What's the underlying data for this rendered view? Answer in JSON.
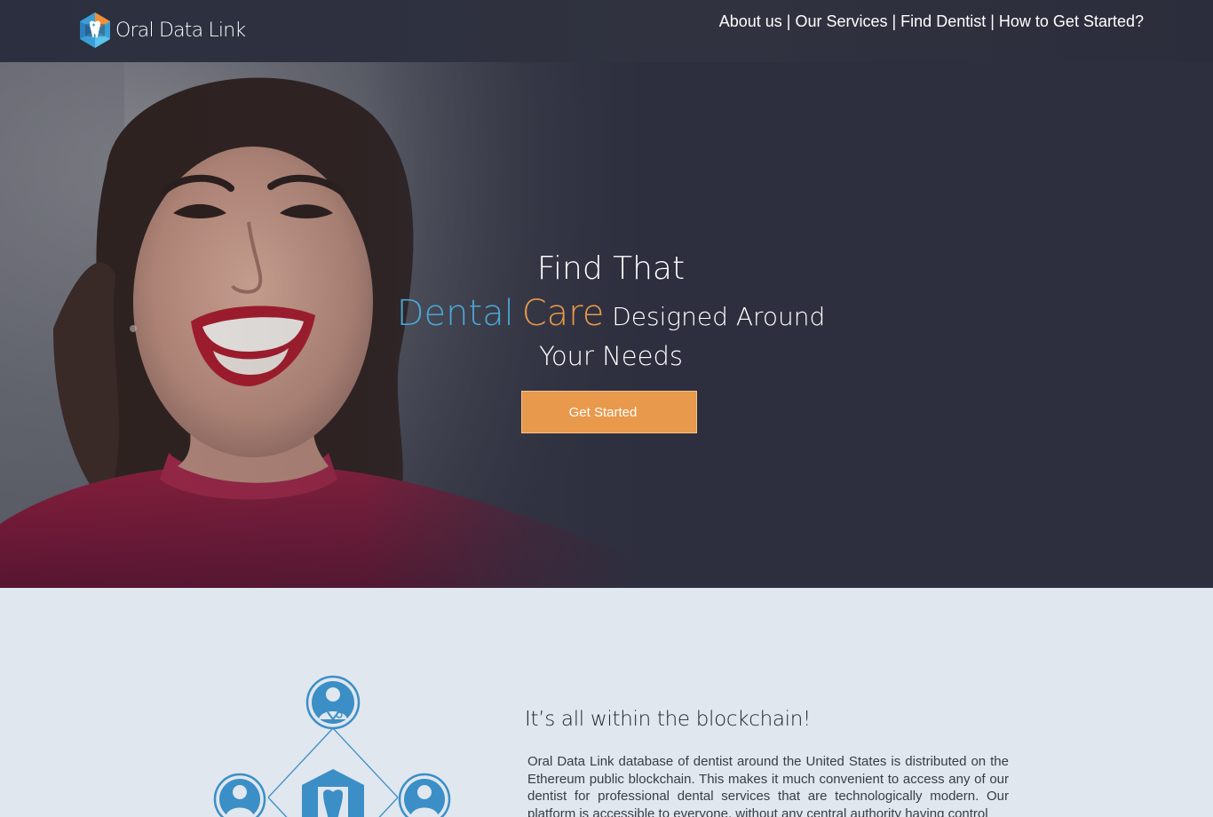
{
  "brand": {
    "name": "Oral Data Link"
  },
  "nav": {
    "items": [
      {
        "label": "About us"
      },
      {
        "label": "Our Services"
      },
      {
        "label": "Find Dentist"
      },
      {
        "label": "How to Get Started?"
      }
    ],
    "separator": "|"
  },
  "hero": {
    "line1": "Find That",
    "highlight_blue": "Dental",
    "highlight_orange": "Care",
    "line2_rest": "Designed Around",
    "line3": "Your Needs",
    "cta_label": "Get Started"
  },
  "blockchain": {
    "title": "It’s all within the blockchain!",
    "body": "Oral Data Link database of dentist around the United States is distributed on the Ethereum public blockchain. This makes it much convenient to access any of our dentist for professional dental services that are technologically modern. Our platform is accessible to everyone, without any central authority having control"
  },
  "colors": {
    "navbar": "#2c2f3f",
    "hero_bg": "#2d2f3e",
    "accent_blue": "#4aa6d4",
    "accent_orange": "#e9974a",
    "cta": "#e8994b",
    "section_bg": "#e0e7ef",
    "diagram_blue": "#3b8fc6"
  },
  "icons": {
    "logo": "tooth-hexagon-logo",
    "diagram_top": "dentist-icon",
    "diagram_left": "user-icon",
    "diagram_right": "user-icon",
    "diagram_center": "tooth-hexagon-icon"
  }
}
